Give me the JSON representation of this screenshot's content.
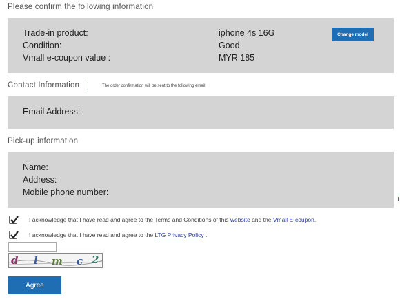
{
  "confirm": {
    "heading": "Please confirm the following information",
    "rows": [
      {
        "label": "Trade-in product:",
        "value": "iphone 4s 16G"
      },
      {
        "label": "Condition:",
        "value": "Good"
      },
      {
        "label": "Vmall e-coupon value :",
        "value": "MYR 185"
      }
    ],
    "change_button": "Change model"
  },
  "contact": {
    "heading": "Contact Information",
    "note": "The order confirmation will be sent to the following email",
    "email_label": "Email Address:"
  },
  "pickup": {
    "heading": "Pick-up information",
    "name_label": "Name:",
    "address_label": "Address:",
    "phone_label": "Mobile phone number:"
  },
  "agreements": {
    "terms": {
      "text_before": "I acknowledge that I have read and agree to the Terms and Conditions of this",
      "link1": "website",
      "text_middle": "and the",
      "link2": "Vmall E-coupon",
      "text_after": ".",
      "checked": true
    },
    "privacy": {
      "text_before": "I acknowledge that I have read and agree to the",
      "link": "LTG Privacy Policy",
      "text_after": ".",
      "checked": true
    }
  },
  "captcha": {
    "input_value": "",
    "image_text": "d l m c 2"
  },
  "agree_button": "Agree",
  "colors": {
    "panel": "#d4d4d4",
    "button": "#1f6db3",
    "link": "#2b3fa8"
  }
}
